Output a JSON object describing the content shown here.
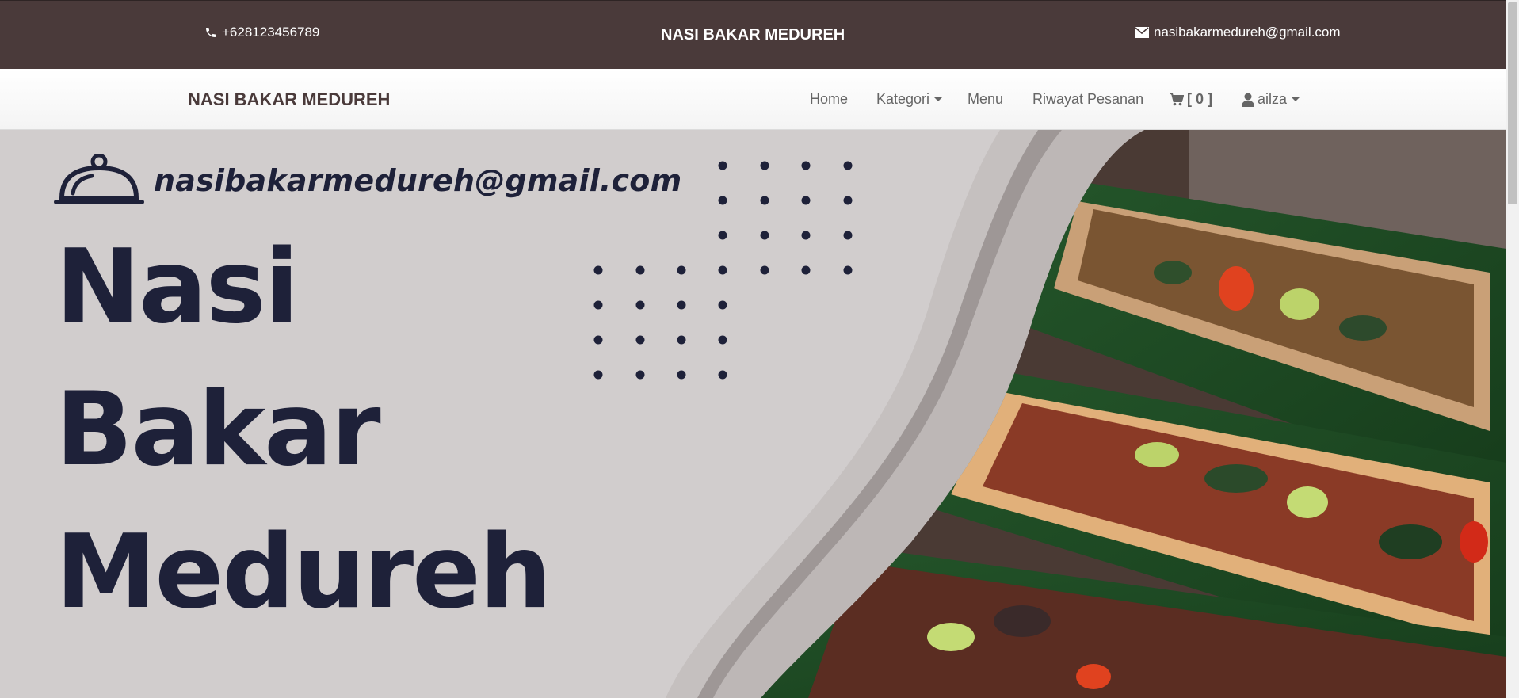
{
  "topbar": {
    "phone": "+628123456789",
    "brand": "NASI BAKAR MEDUREH",
    "email": "nasibakarmedureh@gmail.com"
  },
  "navbar": {
    "brand": "NASI BAKAR MEDUREH",
    "links": {
      "home": "Home",
      "kategori": "Kategori",
      "menu": "Menu",
      "riwayat": "Riwayat Pesanan",
      "cart": "[ 0 ]",
      "user": "ailza"
    }
  },
  "hero": {
    "email": "nasibakarmedureh@gmail.com",
    "title_line1": "Nasi",
    "title_line2": "Bakar",
    "title_line3": "Medureh"
  },
  "colors": {
    "topbar_bg": "#4a3a3a",
    "hero_bg": "#d1cdcd",
    "hero_text": "#1e2139"
  },
  "icons": [
    "phone-icon",
    "envelope-icon",
    "shopping-cart-icon",
    "user-icon",
    "food-cloche-icon"
  ]
}
